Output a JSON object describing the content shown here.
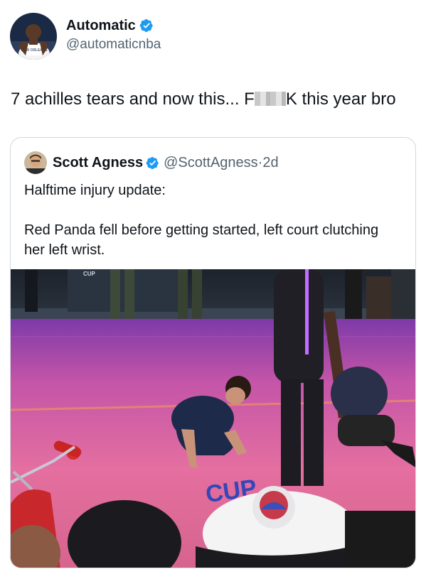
{
  "tweet": {
    "author_name": "Automatic",
    "author_handle": "@automaticnba",
    "text_before": "7 achilles tears and now this... F",
    "text_after": "K this year bro"
  },
  "quoted_tweet": {
    "author_name": "Scott Agness",
    "author_handle": "@ScottAgness",
    "separator": "·",
    "age": "2d",
    "line_1": "Halftime injury update:",
    "line_2": "Red Panda fell before getting started, left court clutching her left wrist.",
    "media_court_text": "CUP",
    "media_sign_text": "CUP"
  },
  "colors": {
    "verified_blue": "#1d9bf0",
    "handle_gray": "#536471",
    "border": "#cfd9de",
    "court_pink": "#e46fa0"
  },
  "icons": {
    "verified": "verified-badge-icon"
  }
}
